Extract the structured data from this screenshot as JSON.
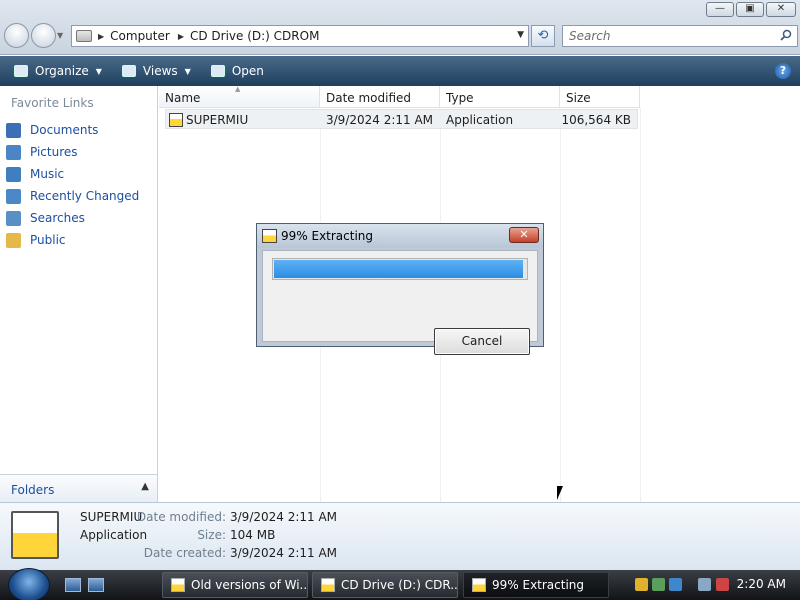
{
  "window": {
    "buttons": {
      "minimize": "—",
      "maximize": "▣",
      "close": "✕"
    }
  },
  "address": {
    "crumbs": [
      "Computer",
      "CD Drive (D:) CDROM"
    ],
    "search_placeholder": "Search"
  },
  "commands": {
    "organize": "Organize",
    "views": "Views",
    "open": "Open",
    "help": "?"
  },
  "sidebar": {
    "title": "Favorite Links",
    "items": [
      {
        "label": "Documents",
        "color": "#3b6fb6"
      },
      {
        "label": "Pictures",
        "color": "#4a86c5"
      },
      {
        "label": "Music",
        "color": "#3f7fc0"
      },
      {
        "label": "Recently Changed",
        "color": "#4c87c8"
      },
      {
        "label": "Searches",
        "color": "#5a8fc6"
      },
      {
        "label": "Public",
        "color": "#e5b84a"
      }
    ],
    "folders_label": "Folders"
  },
  "table": {
    "columns": [
      "Name",
      "Date modified",
      "Type",
      "Size"
    ],
    "rows": [
      {
        "name": "SUPERMIU",
        "date": "3/9/2024 2:11 AM",
        "type": "Application",
        "size": "106,564 KB"
      }
    ]
  },
  "dialog": {
    "title": "99% Extracting",
    "progress_percent": 99,
    "cancel_label": "Cancel"
  },
  "details": {
    "name": "SUPERMIU",
    "type": "Application",
    "date_modified_label": "Date modified:",
    "date_modified": "3/9/2024 2:11 AM",
    "size_label": "Size:",
    "size": "104 MB",
    "date_created_label": "Date created:",
    "date_created": "3/9/2024 2:11 AM"
  },
  "taskbar": {
    "tasks": [
      {
        "label": "Old versions of Wi..."
      },
      {
        "label": "CD Drive (D:) CDR..."
      },
      {
        "label": "99% Extracting"
      }
    ],
    "clock": "2:20 AM"
  }
}
